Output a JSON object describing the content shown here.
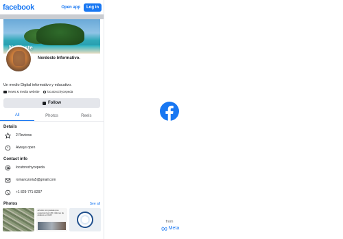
{
  "topbar": {
    "brand": "facebook",
    "open_app": "Open app",
    "login": "Log in"
  },
  "cover": {
    "overlay_text": "Nordeste"
  },
  "profile": {
    "name": "Nordeste Informativo.",
    "bio": "Un medio Digital informativo y educativo.",
    "category": "News & media website",
    "instagram": "locutorochycepeda"
  },
  "actions": {
    "follow": "Follow"
  },
  "tabs": [
    {
      "label": "All"
    },
    {
      "label": "Photos"
    },
    {
      "label": "Reels"
    }
  ],
  "details": {
    "title": "Details",
    "reviews": "2 Reviews",
    "hours": "Always open"
  },
  "contact": {
    "title": "Contact info",
    "instagram": "locutorochycepeda",
    "email": "romanozoria5@gmail.com",
    "phone": "+1 829-771-8297"
  },
  "photos": {
    "title": "Photos",
    "see_all": "See all",
    "p2_caption": "arresto con pareas que especian las 130 millones de dolares en RLB"
  },
  "splash": {
    "from": "from",
    "brand": "Meta"
  },
  "colors": {
    "accent": "#1877f2",
    "button_grey": "#e4e6eb"
  }
}
